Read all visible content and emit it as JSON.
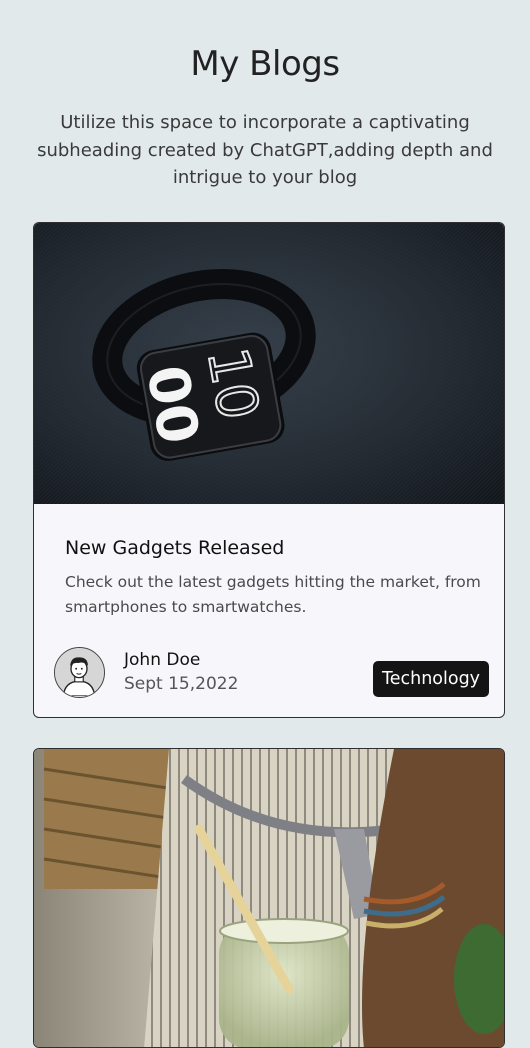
{
  "header": {
    "title": "My Blogs",
    "subtitle": "Utilize this space to incorporate a captivating subheading created by ChatGPT,adding depth and intrigue to your blog"
  },
  "posts": [
    {
      "image_icon": "smartwatch-photo",
      "title": "New Gadgets Released",
      "description": "Check out the latest gadgets hitting the market, from smartphones to smartwatches.",
      "author": "John Doe",
      "date": "Sept 15,2022",
      "tag": "Technology"
    },
    {
      "image_icon": "drink-jar-photo"
    }
  ],
  "colors": {
    "background": "#e2e9ea",
    "card": "#f7f7fb",
    "badge": "#141414"
  }
}
